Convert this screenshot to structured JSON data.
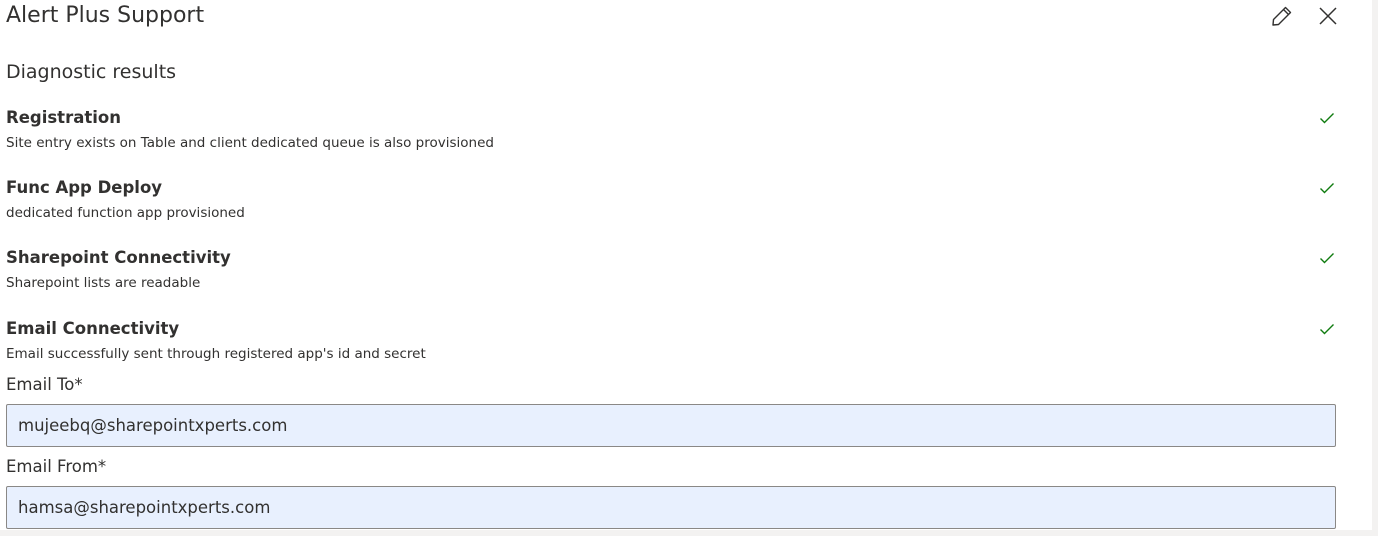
{
  "panel": {
    "title": "Alert Plus Support",
    "subtitle": "Diagnostic results",
    "edit_icon": "pencil-icon",
    "close_icon": "close-icon"
  },
  "diagnostics": [
    {
      "name": "Registration",
      "description": "Site entry exists on Table and client dedicated queue is also provisioned",
      "status_icon": "checkmark-icon"
    },
    {
      "name": "Func App Deploy",
      "description": "dedicated function app provisioned",
      "status_icon": "checkmark-icon"
    },
    {
      "name": "Sharepoint Connectivity",
      "description": "Sharepoint lists are readable",
      "status_icon": "checkmark-icon"
    },
    {
      "name": "Email Connectivity",
      "description": "Email successfully sent through registered app's id and secret",
      "status_icon": "checkmark-icon"
    }
  ],
  "form": {
    "email_to": {
      "label": "Email To*",
      "value": "mujeebq@sharepointxperts.com"
    },
    "email_from": {
      "label": "Email From*",
      "value": "hamsa@sharepointxperts.com"
    }
  },
  "colors": {
    "success": "#107c10",
    "input_fill": "#e8f0fe",
    "text": "#323130"
  }
}
